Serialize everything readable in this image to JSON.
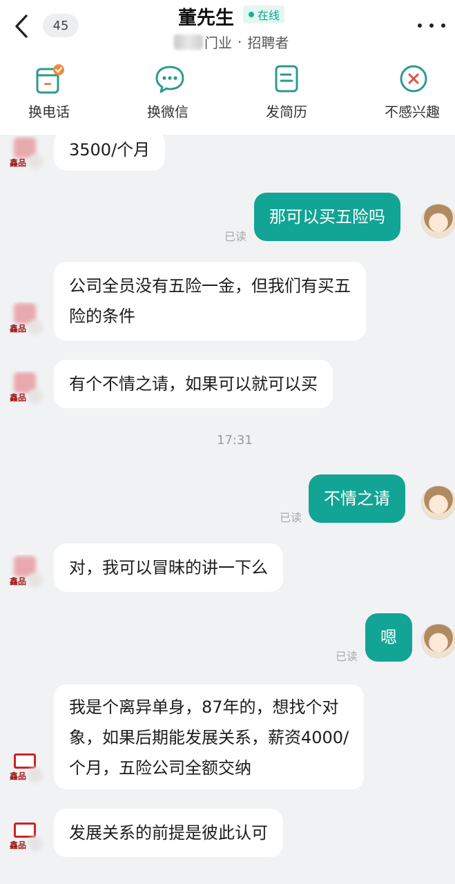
{
  "header": {
    "back_label": "<",
    "unread_count": "45",
    "contact_name": "董先生",
    "online_status": "在线",
    "subtitle_industry": "门业",
    "subtitle_separator": "·",
    "subtitle_role": "招聘者"
  },
  "actions": [
    {
      "label": "换电话",
      "icon": "phone-card-icon"
    },
    {
      "label": "换微信",
      "icon": "wechat-bubble-icon"
    },
    {
      "label": "发简历",
      "icon": "resume-icon"
    },
    {
      "label": "不感兴趣",
      "icon": "not-interested-icon"
    }
  ],
  "colors": {
    "accent": "#12a494",
    "online": "#10a58c",
    "background": "#f1f2f4"
  },
  "messages": [
    {
      "side": "in",
      "lines": [
        "3500/个月"
      ]
    },
    {
      "side": "out",
      "lines": [
        "那可以买五险吗"
      ],
      "status": "已读"
    },
    {
      "side": "in",
      "lines": [
        "公司全员没有五险一金，但我们有买五",
        "险的条件"
      ]
    },
    {
      "side": "in",
      "lines": [
        "有个不情之请，如果可以就可以买"
      ]
    },
    {
      "side": "time",
      "text": "17:31"
    },
    {
      "side": "out",
      "lines": [
        "不情之请"
      ],
      "status": "已读"
    },
    {
      "side": "in",
      "lines": [
        "对，我可以冒昧的讲一下么"
      ]
    },
    {
      "side": "out",
      "lines": [
        "嗯"
      ],
      "status": "已读"
    },
    {
      "side": "in",
      "lines": [
        "我是个离异单身，87年的，想找个对",
        "象，如果后期能发展关系，薪资4000/",
        "个月，五险公司全额交纳"
      ]
    },
    {
      "side": "in",
      "lines": [
        "发展关系的前提是彼此认可"
      ]
    }
  ],
  "avatar_logo_text": "鑫品"
}
